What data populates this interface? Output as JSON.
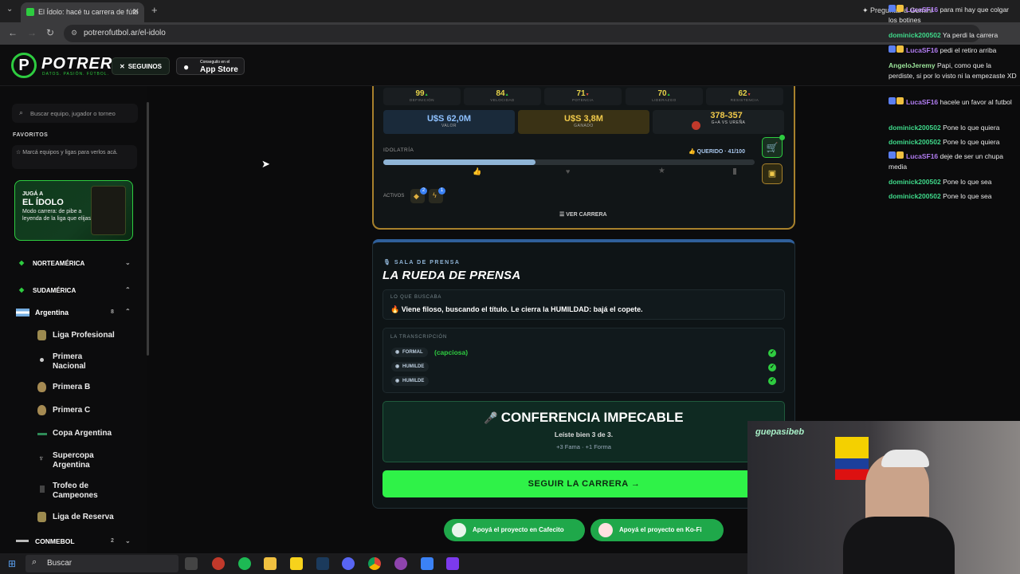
{
  "browser": {
    "tab_title": "El Ídolo: hacé tu carrera de fútb",
    "url": "potrerofutbol.ar/el-idolo",
    "gemini_label": "Preguntar a Gemini"
  },
  "header": {
    "brand": "POTRERO",
    "tagline": "DATOS. PASIÓN. FÚTBOL.",
    "x_button": "SEGUINOS",
    "app_store_small": "Conseguilo en el",
    "app_store_label": "App Store"
  },
  "sidebar": {
    "search_placeholder": "Buscar equipo, jugador o torneo",
    "favorites_heading": "FAVORITOS",
    "favorites_hint": "Marcá equipos y ligas para verlos acá.",
    "promo": {
      "pre": "JUGÁ A",
      "title": "EL ÍDOLO",
      "desc": "Modo carrera: de pibe a leyenda de la liga que elijas"
    },
    "regions": [
      {
        "label": "NORTEAMÉRICA"
      },
      {
        "label": "SUDAMÉRICA"
      }
    ],
    "country": {
      "label": "Argentina",
      "count": "8"
    },
    "leagues": [
      "Liga Profesional",
      "Primera Nacional",
      "Primera B",
      "Primera C",
      "Copa Argentina",
      "Supercopa Argentina",
      "Trofeo de Campeones",
      "Liga de Reserva"
    ],
    "conmebol": {
      "label": "CONMEBOL",
      "count": "2"
    }
  },
  "career": {
    "stats": [
      {
        "value": "99",
        "label": "DEFINICIÓN"
      },
      {
        "value": "84",
        "label": "VELOCIDAD"
      },
      {
        "value": "71",
        "label": "POTENCIA"
      },
      {
        "value": "70",
        "label": "LIDERAZGO"
      },
      {
        "value": "62",
        "label": "RESISTENCIA"
      }
    ],
    "valor": {
      "value": "U$S 62,0M",
      "label": "VALOR"
    },
    "ganado": {
      "value": "U$S 3,8M",
      "label": "GANADO"
    },
    "ga": {
      "value": "378-357",
      "label": "G+A VS UREÑA"
    },
    "idolatria_label": "IDOLATRÍA",
    "idolatria_status": "QUERIDO · 41/100",
    "idolatria_fraction": 0.41,
    "activos_label": "ACTIVOS",
    "activos_badges": [
      "2",
      "1"
    ],
    "ver_carrera": "VER CARRERA"
  },
  "press": {
    "kicker": "SALA DE PRENSA",
    "title": "LA RUEDA DE PRENSA",
    "buscaba_label": "LO QUE BUSCABA",
    "buscaba_text": "Viene filoso, buscando el título. Le cierra la HUMILDAD: bajá el copete.",
    "transcripcion_label": "LA TRANSCRIPCIÓN",
    "rows": [
      {
        "tag": "FORMAL",
        "note": "(capciosa)"
      },
      {
        "tag": "HUMILDE",
        "note": ""
      },
      {
        "tag": "HUMILDE",
        "note": ""
      }
    ],
    "result_title": "CONFERENCIA IMPECABLE",
    "result_sub": "Leíste bien 3 de 3.",
    "result_rewards": "+3 Fama · +1 Forma",
    "cta": "SEGUIR LA CARRERA →"
  },
  "support": {
    "cafecito": "Apoyá el proyecto en Cafecito",
    "kofi": "Apoyá el proyecto en Ko-Fi"
  },
  "chat": [
    {
      "user": "LucaSF16",
      "color": "#b07cf0",
      "text": "para mi hay que colgar los botines"
    },
    {
      "user": "dominick200502",
      "color": "#3fd98a",
      "text": "Ya perdi la carrera"
    },
    {
      "user": "LucaSF16",
      "color": "#b07cf0",
      "text": "pedi el retiro arriba"
    },
    {
      "user": "AngeloJeremy",
      "color": "#9be39a",
      "text": "Papi, como que la perdiste, si por lo visto ni la empezaste XD"
    },
    {
      "user": "LucaSF16",
      "color": "#b07cf0",
      "text": "hacele un favor al futbol"
    },
    {
      "user": "dominick200502",
      "color": "#3fd98a",
      "text": "Pone lo que quiera"
    },
    {
      "user": "dominick200502",
      "color": "#3fd98a",
      "text": "Pone lo que quiera"
    },
    {
      "user": "LucaSF16",
      "color": "#b07cf0",
      "text": "deje de ser un chupa media"
    },
    {
      "user": "dominick200502",
      "color": "#3fd98a",
      "text": "Pone lo que sea"
    },
    {
      "user": "dominick200502",
      "color": "#3fd98a",
      "text": "Pone lo que sea"
    }
  ],
  "webcam": {
    "overlay_text": "guepasibeb"
  },
  "taskbar": {
    "search_label": "Buscar"
  }
}
